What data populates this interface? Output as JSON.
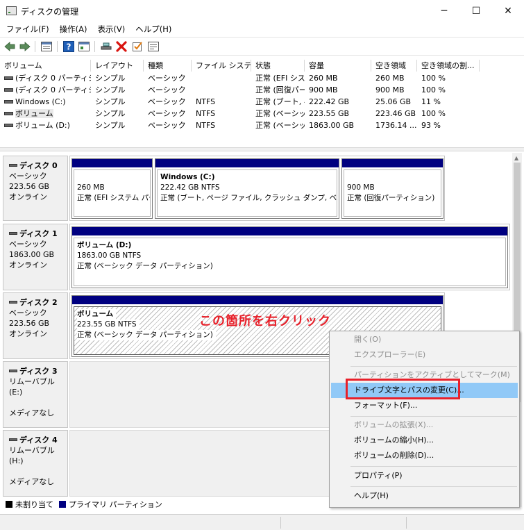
{
  "window": {
    "title": "ディスクの管理",
    "controls": {
      "minimize": "─",
      "maximize": "☐",
      "close": "✕"
    }
  },
  "menu": [
    "ファイル(F)",
    "操作(A)",
    "表示(V)",
    "ヘルプ(H)"
  ],
  "toolbar": {
    "icons": [
      "back-icon",
      "forward-icon",
      "show-hide-tree-icon",
      "help-icon",
      "properties-icon",
      "connect-icon",
      "delete-icon",
      "check-icon",
      "settings-icon"
    ]
  },
  "volume_list": {
    "columns": [
      "ボリューム",
      "レイアウト",
      "種類",
      "ファイル システム",
      "状態",
      "容量",
      "空き領域",
      "空き領域の割..."
    ],
    "rows": [
      [
        "(ディスク 0 パーティション 1)",
        "シンプル",
        "ベーシック",
        "",
        "正常 (EFI システム パーティション)",
        "260 MB",
        "260 MB",
        "100 %"
      ],
      [
        "(ディスク 0 パーティション 4)",
        "シンプル",
        "ベーシック",
        "",
        "正常 (回復パーティション)",
        "900 MB",
        "900 MB",
        "100 %"
      ],
      [
        "Windows (C:)",
        "シンプル",
        "ベーシック",
        "NTFS",
        "正常 (ブート, ページ ファイル)",
        "222.42 GB",
        "25.06 GB",
        "11 %"
      ],
      [
        "ボリューム",
        "シンプル",
        "ベーシック",
        "NTFS",
        "正常 (ベーシック データ パーティション)",
        "223.55 GB",
        "223.46 GB",
        "100 %"
      ],
      [
        "ボリューム (D:)",
        "シンプル",
        "ベーシック",
        "NTFS",
        "正常 (ベーシック データ パーティション)",
        "1863.00 GB",
        "1736.14 ...",
        "93 %"
      ]
    ]
  },
  "disks": [
    {
      "title": "ディスク 0",
      "type": "ベーシック",
      "size": "223.56 GB",
      "status": "オンライン",
      "partitions": [
        {
          "name": "",
          "size": "260 MB",
          "status": "正常 (EFI システム パーティション)"
        },
        {
          "name": "Windows  (C:)",
          "size": "222.42 GB NTFS",
          "status": "正常 (ブート, ページ ファイル, クラッシュ ダンプ, ベーシック データ パーティション)"
        },
        {
          "name": "",
          "size": "900 MB",
          "status": "正常 (回復パーティション)"
        }
      ]
    },
    {
      "title": "ディスク 1",
      "type": "ベーシック",
      "size": "1863.00 GB",
      "status": "オンライン",
      "partitions": [
        {
          "name": "ボリューム  (D:)",
          "size": "1863.00 GB NTFS",
          "status": "正常 (ベーシック データ パーティション)"
        }
      ]
    },
    {
      "title": "ディスク 2",
      "type": "ベーシック",
      "size": "223.56 GB",
      "status": "オンライン",
      "partitions": [
        {
          "name": "ボリューム",
          "size": "223.55 GB NTFS",
          "status": "正常 (ベーシック データ パーティション)"
        }
      ]
    },
    {
      "title": "ディスク 3",
      "type": "リムーバブル (E:)",
      "size": "",
      "status": "メディアなし",
      "partitions": []
    },
    {
      "title": "ディスク 4",
      "type": "リムーバブル (H:)",
      "size": "",
      "status": "メディアなし",
      "partitions": []
    }
  ],
  "annotation": "この箇所を右クリック",
  "legend": [
    {
      "label": "未割り当て",
      "color": "#000000"
    },
    {
      "label": "プライマリ パーティション",
      "color": "#000080"
    }
  ],
  "context_menu": {
    "items": [
      {
        "label": "開く(O)",
        "enabled": false
      },
      {
        "label": "エクスプローラー(E)",
        "enabled": false
      },
      {
        "label": "パーティションをアクティブとしてマーク(M)",
        "enabled": false
      },
      {
        "label": "ドライブ文字とパスの変更(C)...",
        "enabled": true,
        "highlighted": true
      },
      {
        "label": "フォーマット(F)...",
        "enabled": true
      },
      {
        "label": "ボリュームの拡張(X)...",
        "enabled": false
      },
      {
        "label": "ボリュームの縮小(H)...",
        "enabled": true
      },
      {
        "label": "ボリュームの削除(D)...",
        "enabled": true
      },
      {
        "label": "プロパティ(P)",
        "enabled": true
      },
      {
        "label": "ヘルプ(H)",
        "enabled": true
      }
    ]
  },
  "colors": {
    "primary_partition": "#000080",
    "highlight": "#91c9f7",
    "annotation_red": "#e8202a"
  }
}
